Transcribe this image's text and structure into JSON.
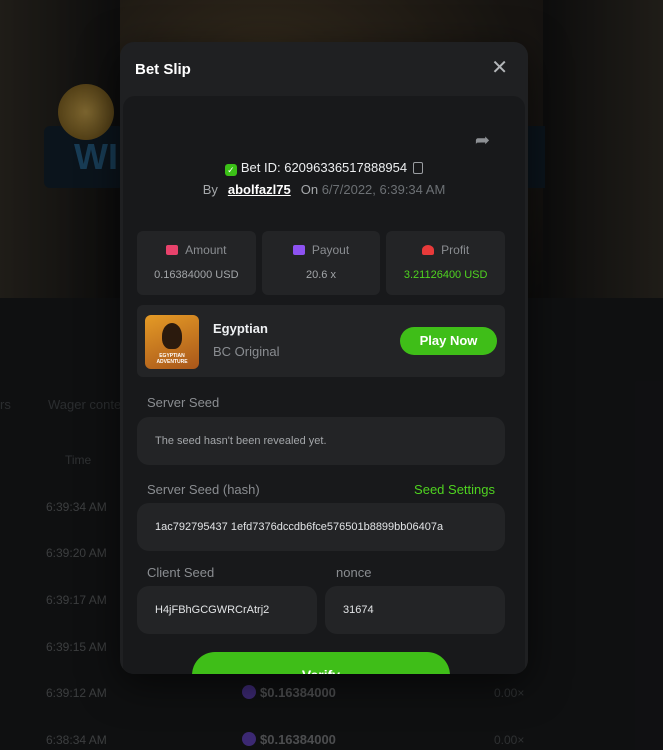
{
  "background": {
    "banner_letter": "WI",
    "tabs": [
      "rs",
      "Wager contest"
    ],
    "column_time": "Time",
    "rows": [
      {
        "time": "6:39:34 AM"
      },
      {
        "time": "6:39:20 AM"
      },
      {
        "time": "6:39:17 AM"
      },
      {
        "time": "6:39:15 AM"
      },
      {
        "time": "6:39:12 AM",
        "amount": "$0.16384000",
        "multiplier": "0.00×"
      },
      {
        "time": "6:38:34 AM",
        "amount": "$0.16384000",
        "multiplier": "0.00×"
      }
    ]
  },
  "modal": {
    "title": "Bet Slip",
    "bet_id_label": "Bet ID: 620963365178889​54",
    "by_label": "By",
    "username": "abolfazl75",
    "on_label": "On",
    "date": "6/7/2022, 6:39:34 AM",
    "stats": {
      "amount": {
        "label": "Amount",
        "value": "0.16384000 USD"
      },
      "payout": {
        "label": "Payout",
        "value": "20.6 x"
      },
      "profit": {
        "label": "Profit",
        "value": "3.21126400 USD"
      }
    },
    "game": {
      "name": "Egyptian",
      "provider": "BC Original",
      "thumb_caption": "EGYPTIAN ADVENTURE",
      "play_label": "Play Now"
    },
    "server_seed": {
      "label": "Server Seed",
      "value": "The seed hasn't been revealed yet."
    },
    "server_seed_hash": {
      "label": "Server Seed (hash)",
      "settings_label": "Seed Settings",
      "value": "1ac792795437 1efd7376dccdb6fce576501b8899bb06407a"
    },
    "client_seed": {
      "label": "Client Seed",
      "value": "H4jFBhGCGWRCrAtrj2"
    },
    "nonce": {
      "label": "nonce",
      "value": "31674"
    },
    "verify_label": "Verify"
  },
  "colors": {
    "accent_green": "#3fbe18",
    "profit_green": "#4fd320",
    "modal_bg": "#1f2022",
    "amount_icon": "#e8426b",
    "payout_icon": "#8d52f2",
    "profit_icon": "#e83a3a"
  }
}
